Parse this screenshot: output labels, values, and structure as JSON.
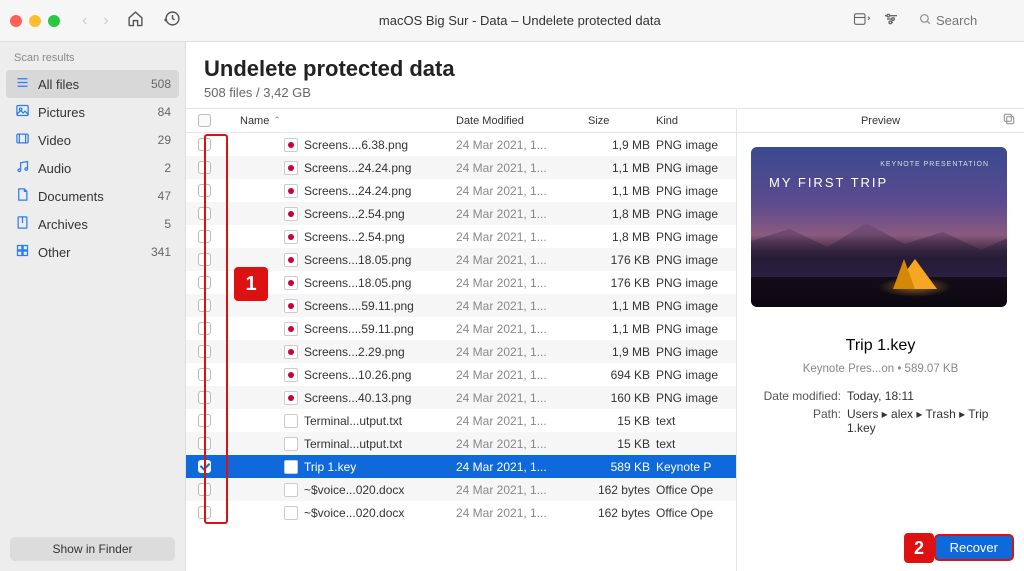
{
  "window": {
    "title": "macOS Big Sur - Data – Undelete protected data"
  },
  "search": {
    "placeholder": "Search"
  },
  "sidebar": {
    "header": "Scan results",
    "items": [
      {
        "icon": "list",
        "label": "All files",
        "count": "508",
        "active": true
      },
      {
        "icon": "picture",
        "label": "Pictures",
        "count": "84"
      },
      {
        "icon": "video",
        "label": "Video",
        "count": "29"
      },
      {
        "icon": "audio",
        "label": "Audio",
        "count": "2"
      },
      {
        "icon": "document",
        "label": "Documents",
        "count": "47"
      },
      {
        "icon": "archive",
        "label": "Archives",
        "count": "5"
      },
      {
        "icon": "other",
        "label": "Other",
        "count": "341"
      }
    ],
    "footer_button": "Show in Finder"
  },
  "content": {
    "title": "Undelete protected data",
    "subtitle": "508 files / 3,42 GB"
  },
  "columns": {
    "name": "Name",
    "date": "Date Modified",
    "size": "Size",
    "kind": "Kind"
  },
  "rows": [
    {
      "name": "Screens....6.38.png",
      "date": "24 Mar 2021, 1...",
      "size": "1,9 MB",
      "kind": "PNG image",
      "type": "png"
    },
    {
      "name": "Screens...24.24.png",
      "date": "24 Mar 2021, 1...",
      "size": "1,1 MB",
      "kind": "PNG image",
      "type": "png"
    },
    {
      "name": "Screens...24.24.png",
      "date": "24 Mar 2021, 1...",
      "size": "1,1 MB",
      "kind": "PNG image",
      "type": "png"
    },
    {
      "name": "Screens...2.54.png",
      "date": "24 Mar 2021, 1...",
      "size": "1,8 MB",
      "kind": "PNG image",
      "type": "png"
    },
    {
      "name": "Screens...2.54.png",
      "date": "24 Mar 2021, 1...",
      "size": "1,8 MB",
      "kind": "PNG image",
      "type": "png"
    },
    {
      "name": "Screens...18.05.png",
      "date": "24 Mar 2021, 1...",
      "size": "176 KB",
      "kind": "PNG image",
      "type": "png"
    },
    {
      "name": "Screens...18.05.png",
      "date": "24 Mar 2021, 1...",
      "size": "176 KB",
      "kind": "PNG image",
      "type": "png"
    },
    {
      "name": "Screens....59.11.png",
      "date": "24 Mar 2021, 1...",
      "size": "1,1 MB",
      "kind": "PNG image",
      "type": "png"
    },
    {
      "name": "Screens....59.11.png",
      "date": "24 Mar 2021, 1...",
      "size": "1,1 MB",
      "kind": "PNG image",
      "type": "png"
    },
    {
      "name": "Screens...2.29.png",
      "date": "24 Mar 2021, 1...",
      "size": "1,9 MB",
      "kind": "PNG image",
      "type": "png"
    },
    {
      "name": "Screens...10.26.png",
      "date": "24 Mar 2021, 1...",
      "size": "694 KB",
      "kind": "PNG image",
      "type": "png"
    },
    {
      "name": "Screens...40.13.png",
      "date": "24 Mar 2021, 1...",
      "size": "160 KB",
      "kind": "PNG image",
      "type": "png"
    },
    {
      "name": "Terminal...utput.txt",
      "date": "24 Mar 2021, 1...",
      "size": "15 KB",
      "kind": "text",
      "type": "txt"
    },
    {
      "name": "Terminal...utput.txt",
      "date": "24 Mar 2021, 1...",
      "size": "15 KB",
      "kind": "text",
      "type": "txt"
    },
    {
      "name": "Trip 1.key",
      "date": "24 Mar 2021, 1...",
      "size": "589 KB",
      "kind": "Keynote P",
      "type": "key",
      "selected": true
    },
    {
      "name": "~$voice...020.docx",
      "date": "24 Mar 2021, 1...",
      "size": "162 bytes",
      "kind": "Office Ope",
      "type": "docx"
    },
    {
      "name": "~$voice...020.docx",
      "date": "24 Mar 2021, 1...",
      "size": "162 bytes",
      "kind": "Office Ope",
      "type": "docx"
    }
  ],
  "preview": {
    "header": "Preview",
    "thumb_title": "MY FIRST TRIP",
    "thumb_sub": "KEYNOTE PRESENTATION",
    "filename": "Trip 1.key",
    "meta": "Keynote Pres...on • 589.07 KB",
    "date_modified_label": "Date modified:",
    "date_modified_value": "Today, 18:11",
    "path_label": "Path:",
    "path_value": "Users ▸ alex ▸ Trash ▸ Trip 1.key",
    "recover_button": "Recover"
  },
  "callouts": {
    "one": "1",
    "two": "2"
  }
}
